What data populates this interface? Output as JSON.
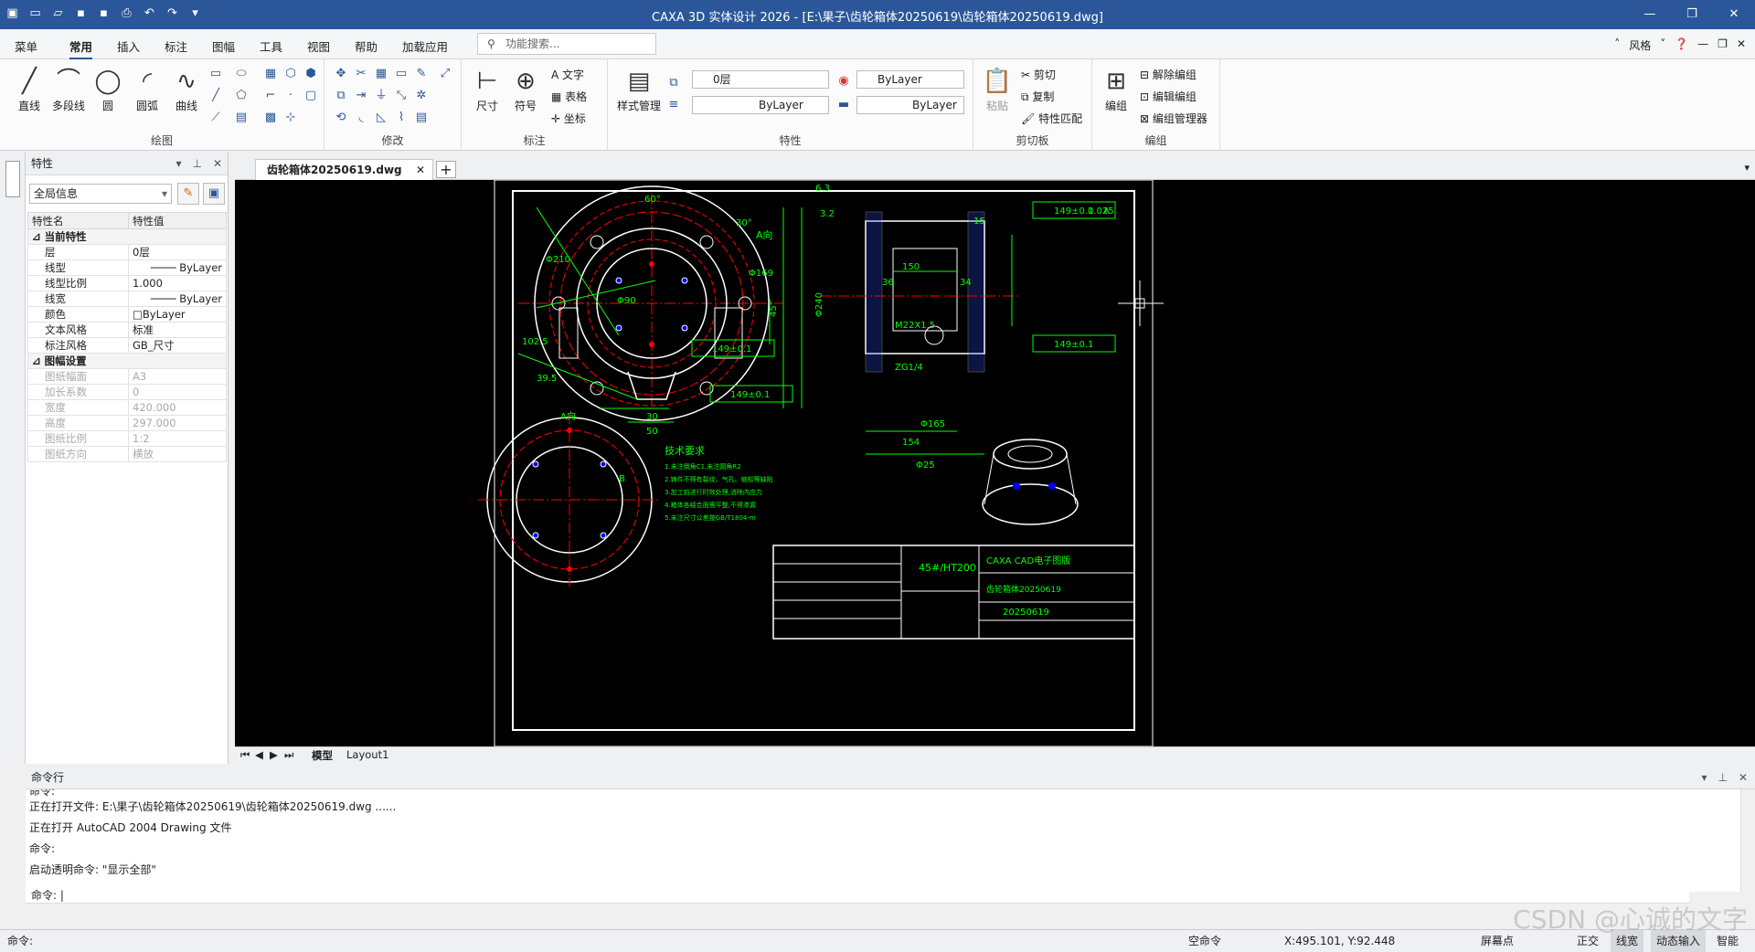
{
  "titlebar": {
    "title": "CAXA 3D 实体设计 2026 - [E:\\果子\\齿轮箱体20250619\\齿轮箱体20250619.dwg]"
  },
  "menubar": {
    "tabs": [
      "菜单",
      "常用",
      "插入",
      "标注",
      "图幅",
      "工具",
      "视图",
      "帮助",
      "加载应用"
    ],
    "active": "常用",
    "search_placeholder": "功能搜索...",
    "style_label": "风格"
  },
  "ribbon": {
    "draw": {
      "label": "绘图",
      "tools": [
        "直线",
        "多段线",
        "圆",
        "圆弧",
        "曲线"
      ]
    },
    "modify": {
      "label": "修改"
    },
    "annotate": {
      "label": "标注",
      "tools": [
        "尺寸",
        "符号"
      ],
      "small": [
        "文字",
        "表格",
        "坐标"
      ]
    },
    "properties": {
      "label": "特性",
      "style_mgr": "样式管理",
      "layer": "0层",
      "color": "ByLayer",
      "linetype": "ByLayer",
      "lineweight": "ByLayer"
    },
    "clipboard": {
      "label": "剪切板",
      "paste": "粘贴",
      "cut": "剪切",
      "copy": "复制",
      "match": "特性匹配"
    },
    "group": {
      "label": "编组",
      "group": "编组",
      "ungroup": "解除编组",
      "edit": "编辑编组",
      "manager": "编组管理器"
    }
  },
  "properties_panel": {
    "title": "特性",
    "filter": "全局信息",
    "col_name": "特性名",
    "col_value": "特性值",
    "cat1": "当前特性",
    "rows1": [
      {
        "k": "层",
        "v": "0层"
      },
      {
        "k": "线型",
        "v": "ByLayer"
      },
      {
        "k": "线型比例",
        "v": "1.000"
      },
      {
        "k": "线宽",
        "v": "ByLayer"
      },
      {
        "k": "颜色",
        "v": "ByLayer"
      },
      {
        "k": "文本风格",
        "v": "标准"
      },
      {
        "k": "标注风格",
        "v": "GB_尺寸"
      }
    ],
    "cat2": "图幅设置",
    "rows2": [
      {
        "k": "图纸幅面",
        "v": "A3"
      },
      {
        "k": "加长系数",
        "v": "0"
      },
      {
        "k": "宽度",
        "v": "420.000"
      },
      {
        "k": "高度",
        "v": "297.000"
      },
      {
        "k": "图纸比例",
        "v": "1:2"
      },
      {
        "k": "图纸方向",
        "v": "横放"
      }
    ]
  },
  "doc_tab": "齿轮箱体20250619.dwg",
  "sheet_tabs": [
    "模型",
    "Layout1"
  ],
  "drawing": {
    "view_label": "A向",
    "tech_title": "技术要求",
    "tech_lines": [
      "1.未注倒角C1,未注圆角R2",
      "2.铸件不得有裂纹、气孔、缩松等缺陷",
      "3.加工前进行时效处理,消除内应力",
      "4.箱体各结合面需平整,不得渗漏",
      "5.未注尺寸公差按GB/T1804-m"
    ],
    "material": "45#/HT200",
    "company": "CAXA CAD电子图版",
    "part_name": "齿轮箱体20250619",
    "code": "20250619",
    "dims": [
      "60°",
      "30°",
      "Φ210",
      "Φ169",
      "Φ90",
      "102.5",
      "39.5",
      "30",
      "50",
      "45°",
      "Φ240",
      "Φ165",
      "Φ25",
      "154",
      "150",
      "149±0.1",
      "0.025",
      "A",
      "B",
      "6.3",
      "3.2",
      "36",
      "34",
      "15",
      "ZG1/4",
      "M22X1.5"
    ]
  },
  "command": {
    "title": "命令行",
    "log": [
      "命令:",
      "正在打开文件: E:\\果子\\齿轮箱体20250619\\齿轮箱体20250619.dwg ......",
      "正在打开 AutoCAD 2004 Drawing 文件",
      "命令:",
      "启动透明命令: \"显示全部\""
    ],
    "prompt": "命令:"
  },
  "status": {
    "left": "命令:",
    "state": "空命令",
    "coords": "X:495.101, Y:92.448",
    "snap": "屏幕点",
    "ortho": "正交",
    "lineweight": "线宽",
    "dyn": "动态输入",
    "smart": "智能"
  },
  "watermark": "CSDN @心诚的文字"
}
